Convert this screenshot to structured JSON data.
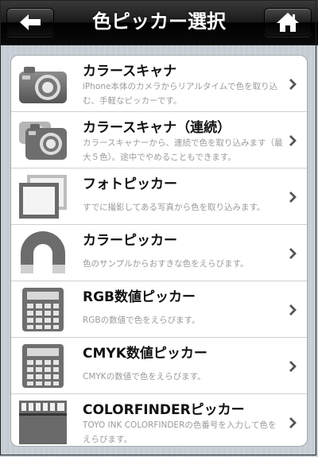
{
  "navbar": {
    "title": "色ピッカー選択",
    "back_icon": "arrow-left-icon",
    "home_icon": "home-icon"
  },
  "items": [
    {
      "title": "カラースキャナ",
      "desc": "iPhone本体のカメラからリアルタイムで色を取り込む、手軽なピッカーです。",
      "icon": "camera-icon"
    },
    {
      "title": "カラースキャナ（連続）",
      "desc": "カラースキャナーから、連続で色を取り込みます（最大５色）。途中でやめることもできます。",
      "icon": "multi-camera-icon"
    },
    {
      "title": "フォトピッカー",
      "desc": "すでに撮影してある写真から色を取り込みます。",
      "icon": "photo-stack-icon"
    },
    {
      "title": "カラーピッカー",
      "desc": "色のサンプルからおすきな色をえらびます。",
      "icon": "magnet-icon"
    },
    {
      "title": "RGB数値ピッカー",
      "desc": "RGBの数値で色をえらびます。",
      "icon": "calculator-icon"
    },
    {
      "title": "CMYK数値ピッカー",
      "desc": "CMYKの数値で色をえらびます。",
      "icon": "calculator-icon"
    },
    {
      "title": "COLORFINDERピッカー",
      "desc": "TOYO INK COLORFINDERの色番号を入力して色をえらびます。",
      "icon": "color-chart-icon"
    }
  ],
  "colors": {
    "nav_bg": "#000000",
    "title_text": "#111111",
    "desc_text": "#9a9a9a",
    "icon_gray": "#6e6e6e"
  }
}
